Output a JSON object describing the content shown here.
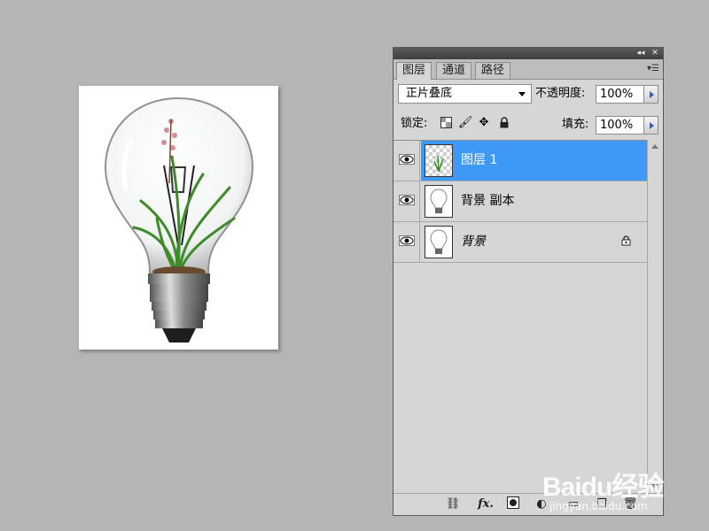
{
  "panel": {
    "tabs": [
      {
        "label": "图层",
        "active": true
      },
      {
        "label": "通道",
        "active": false
      },
      {
        "label": "路径",
        "active": false
      }
    ],
    "blend_mode": "正片叠底",
    "opacity_label": "不透明度:",
    "opacity_value": "100%",
    "lock_label": "锁定:",
    "fill_label": "填充:",
    "fill_value": "100%",
    "layers": [
      {
        "name": "图层 1",
        "selected": true,
        "visible": true,
        "locked": false
      },
      {
        "name": "背景 副本",
        "selected": false,
        "visible": true,
        "locked": false
      },
      {
        "name": "背景",
        "selected": false,
        "visible": true,
        "locked": true
      }
    ]
  },
  "watermark": {
    "brand": "Baidu经验",
    "url": "jingyan.baidu.com"
  },
  "colors": {
    "selection": "#3d99f5",
    "panel_bg": "#d6d6d6",
    "workspace_bg": "#b5b5b5"
  }
}
